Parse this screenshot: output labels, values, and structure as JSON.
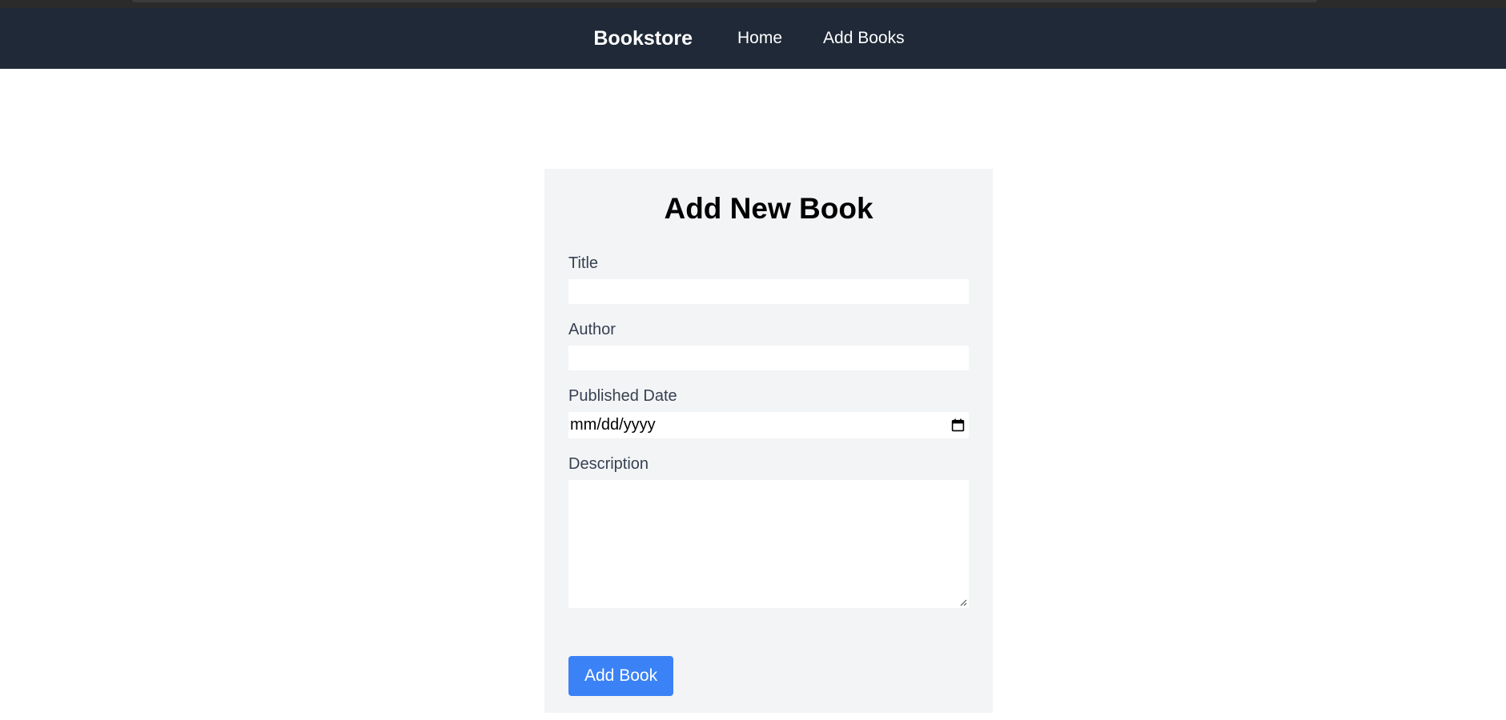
{
  "navbar": {
    "brand": "Bookstore",
    "links": [
      {
        "label": "Home"
      },
      {
        "label": "Add Books"
      }
    ],
    "background": "#1f2937"
  },
  "form": {
    "heading": "Add New Book",
    "fields": {
      "title": {
        "label": "Title",
        "value": ""
      },
      "author": {
        "label": "Author",
        "value": ""
      },
      "published_date": {
        "label": "Published Date",
        "value": "mm/dd/yyyy"
      },
      "description": {
        "label": "Description",
        "value": ""
      }
    },
    "submit_label": "Add Book",
    "accent": "#3b82f6",
    "card_background": "#f3f4f6"
  },
  "icons": {
    "date_picker": "calendar-icon",
    "textarea_resize": "resize-handle-icon"
  }
}
